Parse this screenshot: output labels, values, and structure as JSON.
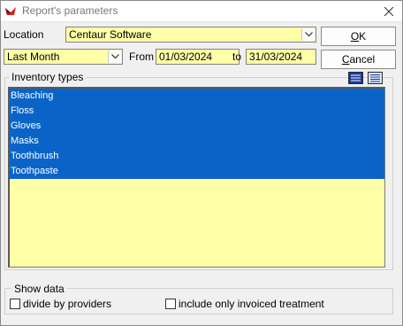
{
  "window": {
    "title": "Report's parameters"
  },
  "location": {
    "label": "Location",
    "value": "Centaur Software"
  },
  "period": {
    "value": "Last Month",
    "from_label": "From",
    "from_value": "01/03/2024",
    "to_label": "to",
    "to_value": "31/03/2024"
  },
  "buttons": {
    "ok_prefix": "",
    "ok_mnemonic": "O",
    "ok_rest": "K",
    "cancel_prefix": "",
    "cancel_mnemonic": "C",
    "cancel_rest": "ancel"
  },
  "inventory": {
    "label": "Inventory types",
    "items": [
      "Bleaching",
      "Floss",
      "Gloves",
      "Masks",
      "Toothbrush",
      "Toothpaste"
    ]
  },
  "show_data": {
    "label": "Show data",
    "divide_by_providers": "divide by providers",
    "invoiced_only": "include only invoiced treatment"
  },
  "colors": {
    "field_yellow": "#ffffa8",
    "selection_blue": "#0a64c8"
  }
}
